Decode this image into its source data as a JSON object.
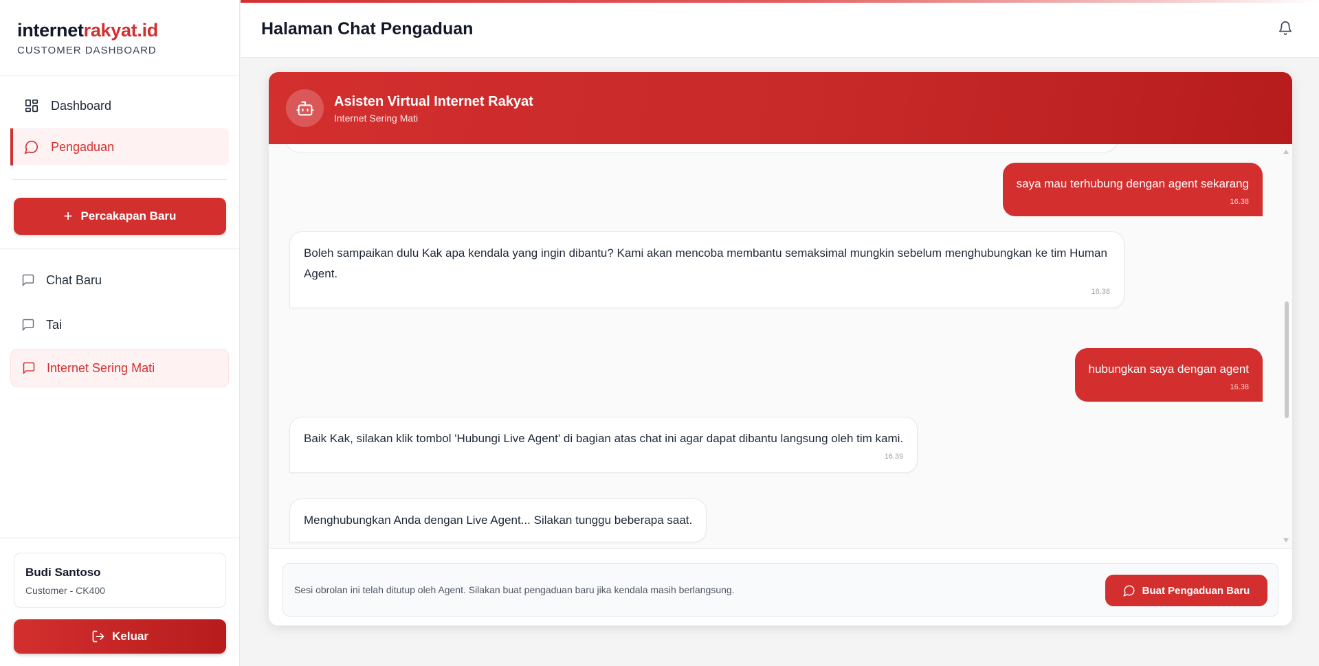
{
  "brand": {
    "name_part1": "internet",
    "name_part2": "rakyat.id",
    "subtitle": "CUSTOMER DASHBOARD"
  },
  "nav": {
    "items": [
      {
        "label": "Dashboard",
        "icon": "grid-icon"
      },
      {
        "label": "Pengaduan",
        "icon": "chat-bubble-icon",
        "active": true
      }
    ]
  },
  "new_chat_button": "Percakapan Baru",
  "history": {
    "items": [
      {
        "label": "Chat Baru"
      },
      {
        "label": "Tai"
      },
      {
        "label": "Internet Sering Mati",
        "active": true
      }
    ]
  },
  "user": {
    "name": "Budi Santoso",
    "role": "Customer - CK400"
  },
  "logout_button": "Keluar",
  "header": {
    "title": "Halaman Chat Pengaduan"
  },
  "chat": {
    "title": "Asisten Virtual Internet Rakyat",
    "subtitle": "Internet Sering Mati",
    "messages": [
      {
        "from": "user",
        "text": "saya mau terhubung dengan agent sekarang",
        "time": "16.38"
      },
      {
        "from": "bot",
        "text": "Boleh sampaikan dulu Kak apa kendala yang ingin dibantu? Kami akan mencoba membantu semaksimal mungkin sebelum menghubungkan ke tim Human Agent.",
        "time": "16.38"
      },
      {
        "from": "user",
        "text": "hubungkan saya dengan agent",
        "time": "16.38"
      },
      {
        "from": "bot",
        "text": "Baik Kak, silakan klik tombol 'Hubungi Live Agent' di bagian atas chat ini agar dapat dibantu langsung oleh tim kami.",
        "time": "16.39"
      },
      {
        "from": "bot",
        "text": "Menghubungkan Anda dengan Live Agent... Silakan tunggu beberapa saat.",
        "time": ""
      }
    ],
    "closed_notice": "Sesi obrolan ini telah ditutup oleh Agent. Silakan buat pengaduan baru jika kendala masih berlangsung.",
    "new_complaint_button": "Buat Pengaduan Baru"
  },
  "colors": {
    "accent": "#d32f2f",
    "accent_dark": "#b71c1c",
    "active_bg": "#fef2f2"
  }
}
